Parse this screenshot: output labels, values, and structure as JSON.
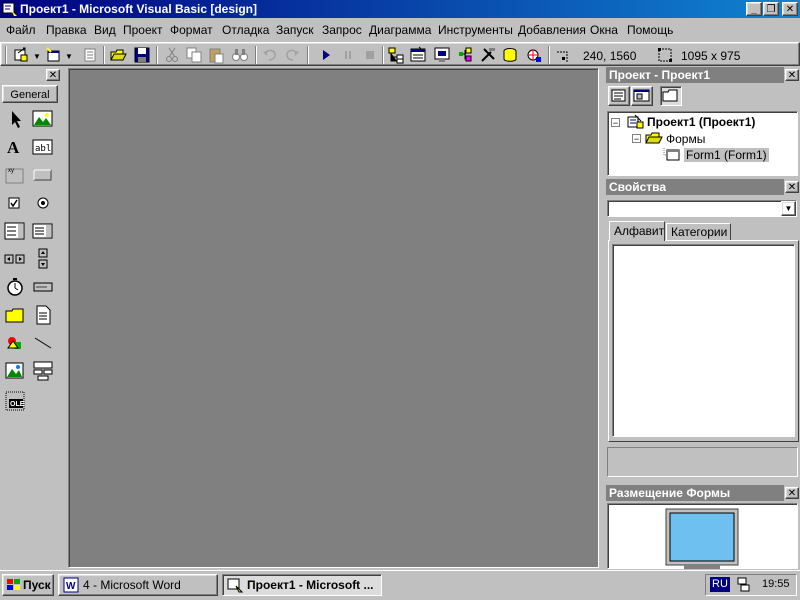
{
  "window": {
    "title": "Проект1 - Microsoft Visual Basic [design]"
  },
  "titlebar_buttons": [
    "_",
    "❐",
    "✕"
  ],
  "menu": [
    "Файл",
    "Правка",
    "Вид",
    "Проект",
    "Формат",
    "Отладка",
    "Запуск",
    "Запрос",
    "Диаграмма",
    "Инструменты",
    "Добавления",
    "Окна",
    "Помощь"
  ],
  "toolbar": {
    "position": "240, 1560",
    "size": "1095 x 975"
  },
  "toolbox": {
    "tab_label": "General"
  },
  "project_panel": {
    "title": "Проект - Проект1",
    "tree": {
      "root": "Проект1 (Проект1)",
      "folder": "Формы",
      "item": "Form1 (Form1)"
    }
  },
  "properties_panel": {
    "title": "Свойства",
    "tabs": [
      "Алфавит",
      "Категории"
    ]
  },
  "layout_panel": {
    "title": "Размещение Формы"
  },
  "taskbar": {
    "start_label": "Пуск",
    "tasks": [
      "4 - Microsoft Word",
      "Проект1 - Microsoft ..."
    ],
    "lang": "RU",
    "clock": "19:55"
  },
  "colors": {
    "title_start": "#000080",
    "title_end": "#1084d0",
    "mdi_bg": "#808080",
    "selection": "#000080"
  }
}
